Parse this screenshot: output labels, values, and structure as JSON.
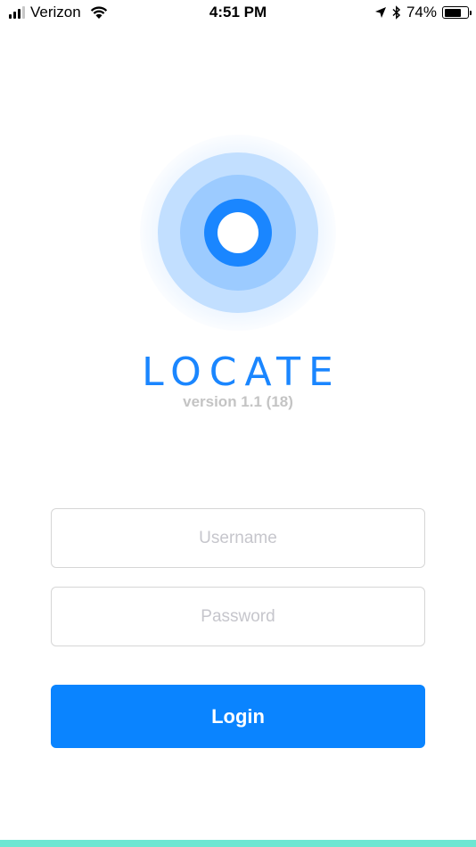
{
  "status_bar": {
    "carrier": "Verizon",
    "time": "4:51 PM",
    "battery_percent": "74%",
    "battery_level": 0.74,
    "icons": [
      "signal-icon",
      "wifi-icon",
      "location-arrow-icon",
      "bluetooth-icon",
      "battery-icon"
    ]
  },
  "app": {
    "title": "LOCATE",
    "version": "version 1.1 (18)"
  },
  "form": {
    "username_placeholder": "Username",
    "username_value": "",
    "password_placeholder": "Password",
    "password_value": "",
    "login_label": "Login"
  },
  "colors": {
    "brand": "#1a86ff",
    "button": "#0a84ff",
    "bottom_strip": "#6ee6d2"
  }
}
